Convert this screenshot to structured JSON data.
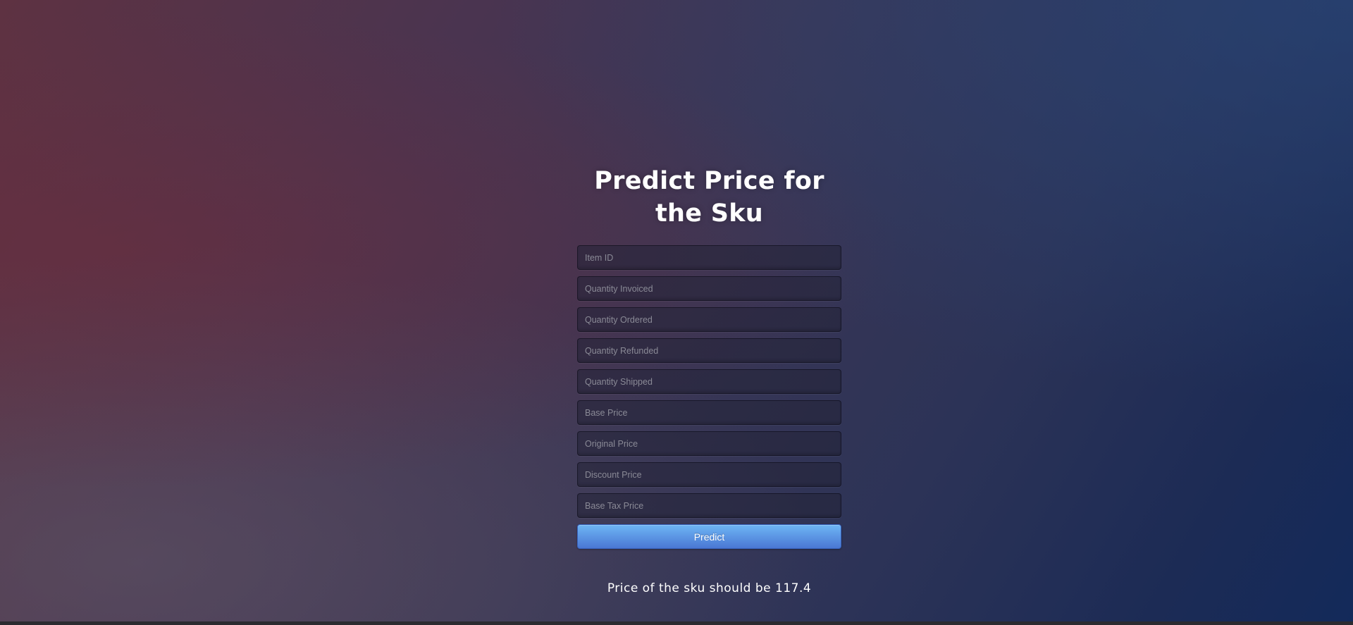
{
  "page": {
    "title": "Predict Price for the Sku"
  },
  "form": {
    "fields": [
      {
        "placeholder": "Item ID",
        "value": ""
      },
      {
        "placeholder": "Quantity Invoiced",
        "value": ""
      },
      {
        "placeholder": "Quantity Ordered",
        "value": ""
      },
      {
        "placeholder": "Quantity Refunded",
        "value": ""
      },
      {
        "placeholder": "Quantity Shipped",
        "value": ""
      },
      {
        "placeholder": "Base Price",
        "value": ""
      },
      {
        "placeholder": "Original Price",
        "value": ""
      },
      {
        "placeholder": "Discount Price",
        "value": ""
      },
      {
        "placeholder": "Base Tax Price",
        "value": ""
      }
    ],
    "submit_label": "Predict"
  },
  "result": {
    "text": "Price of the sku should be 117.4"
  },
  "colors": {
    "button_top": "#6eb6f4",
    "button_bottom": "#4a77d4",
    "text": "#ffffff"
  }
}
